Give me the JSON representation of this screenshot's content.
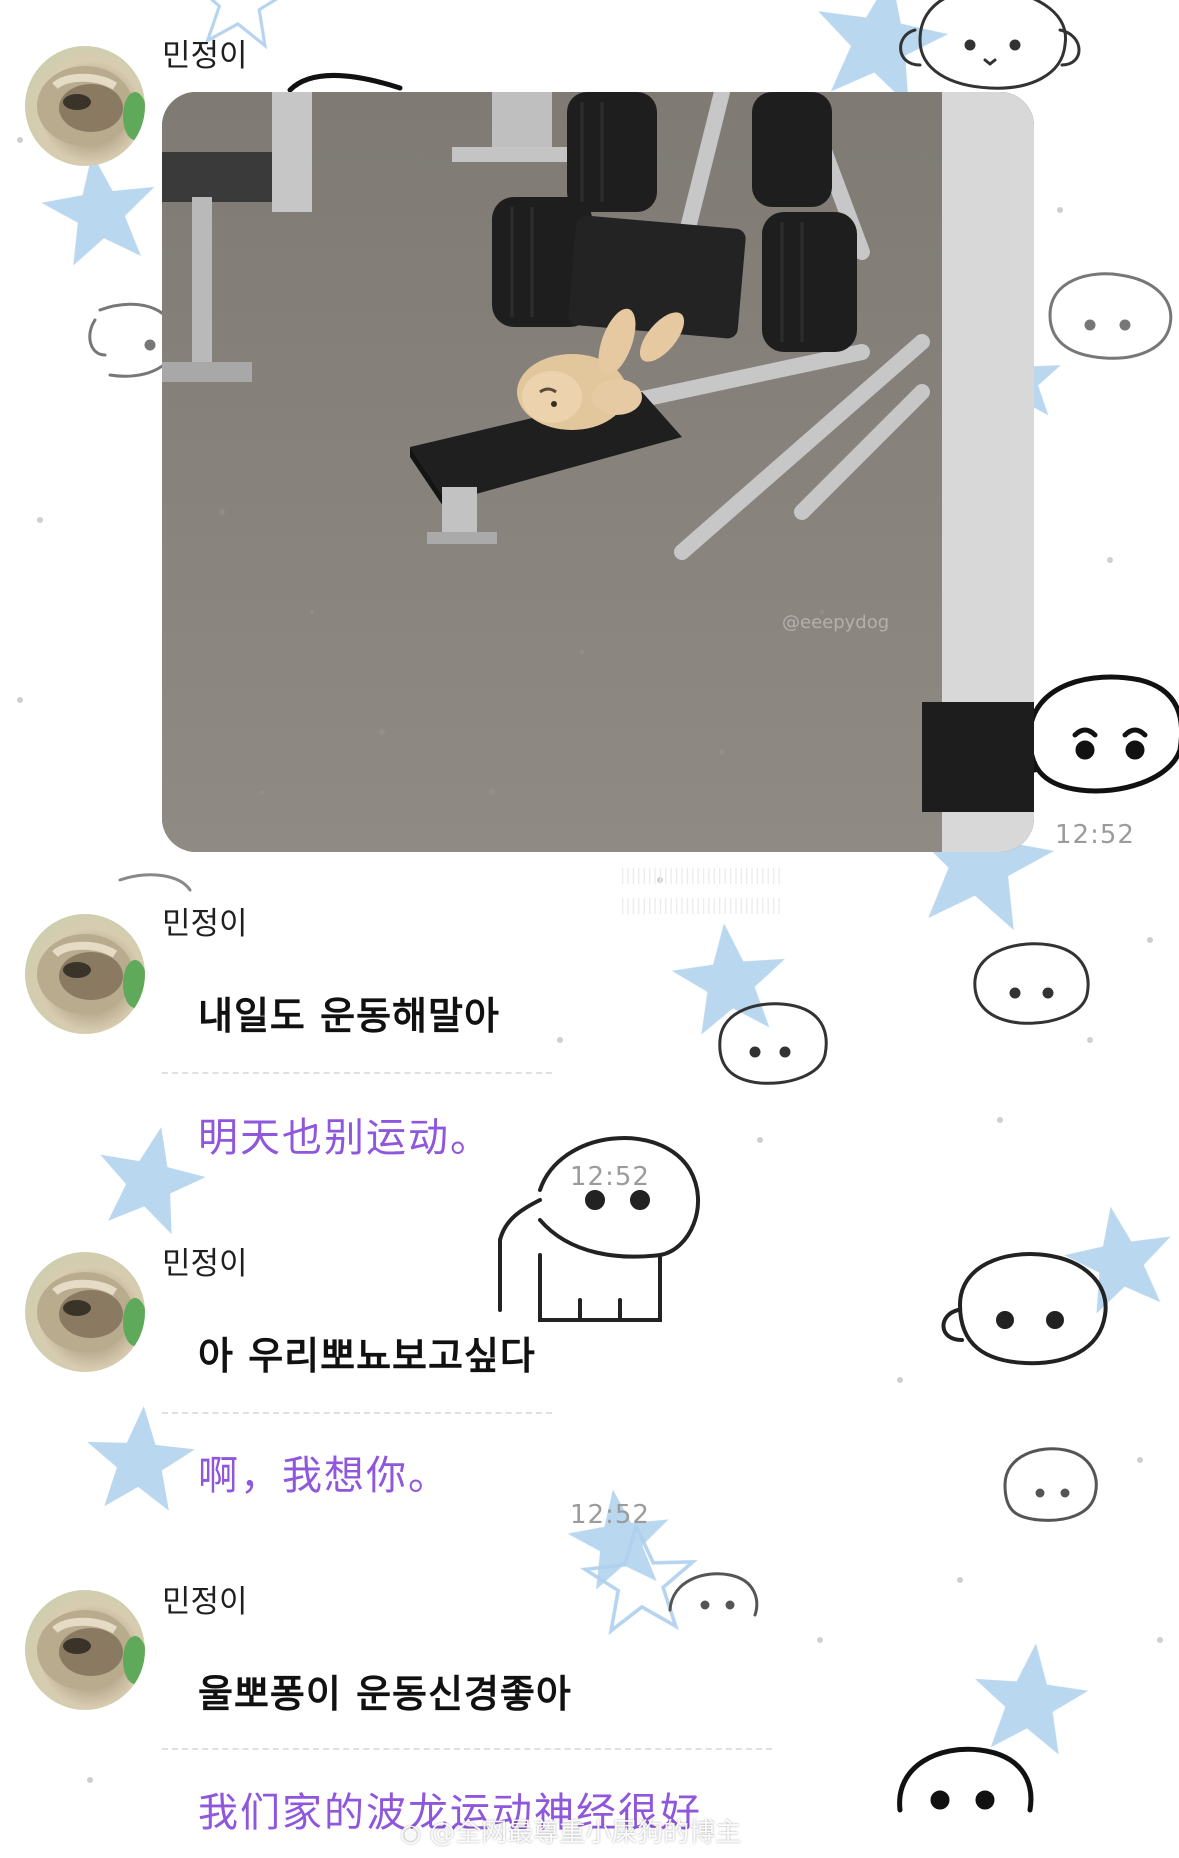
{
  "sender_name": "민정이",
  "photo_message": {
    "image_description_icon": "photo-dog-sleeping-on-gym-bench",
    "photo_watermark": "@eeepydog",
    "time": "12:52"
  },
  "messages": [
    {
      "sender": "민정이",
      "korean": "내일도 운동해말아",
      "chinese": "明天也别运动。",
      "time": "12:52"
    },
    {
      "sender": "민정이",
      "korean": "아 우리뽀뇨보고싶다",
      "chinese": "啊，我想你。",
      "time": "12:52"
    },
    {
      "sender": "민정이",
      "korean": "울뽀퐁이 운동신경좋아",
      "chinese": "我们家的波龙运动神经很好"
    }
  ],
  "watermark": "@全网最尊重小屎狗的博主",
  "colors": {
    "translation_text": "#8e57dc",
    "star": "#a9cdec",
    "doodle": "#222222"
  }
}
